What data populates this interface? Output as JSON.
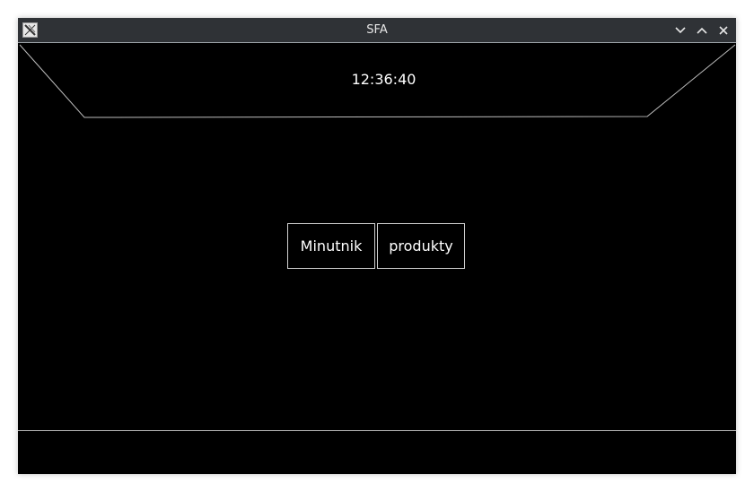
{
  "window": {
    "title": "SFA",
    "icon": "x-app-icon",
    "controls": [
      "minimize-icon",
      "maximize-icon",
      "close-icon"
    ]
  },
  "header": {
    "clock": "12:36:40"
  },
  "main": {
    "buttons": [
      {
        "label": "Minutnik"
      },
      {
        "label": "produkty"
      }
    ]
  },
  "colors": {
    "background": "#000000",
    "titlebar": "#2f3236",
    "text": "#ffffff",
    "outline": "#d0d0d0"
  }
}
